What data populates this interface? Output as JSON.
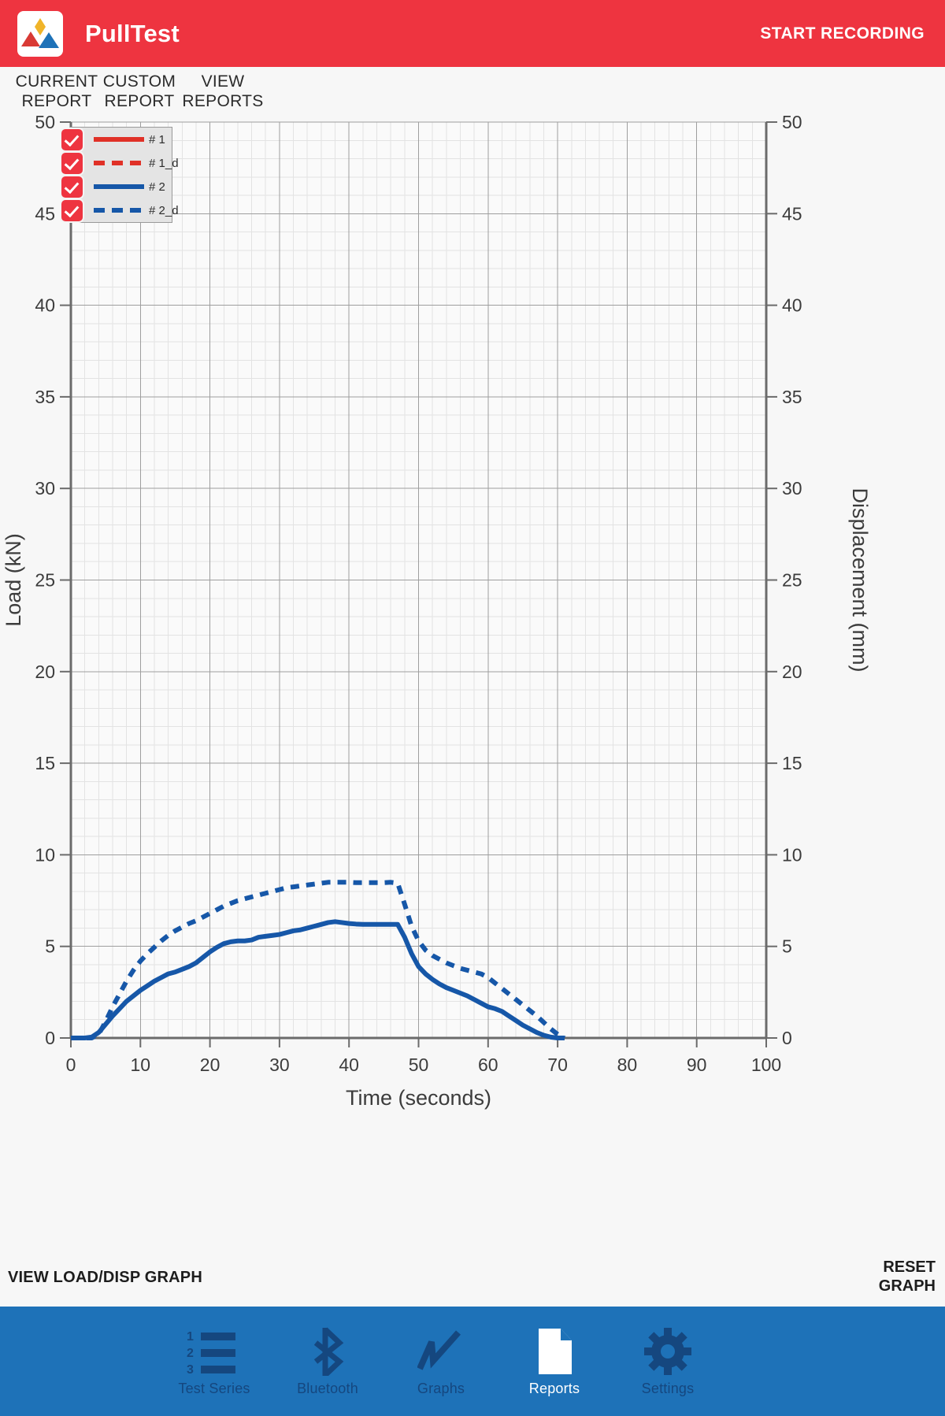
{
  "appbar": {
    "title": "PullTest",
    "start_recording_label": "START RECORDING",
    "logo_icon": "mountains-logo-icon",
    "brand_color": "#ee3440"
  },
  "tabs": [
    {
      "line1": "CURRENT",
      "line2": "REPORT",
      "name": "current-report"
    },
    {
      "line1": "CUSTOM",
      "line2": "REPORT",
      "name": "custom-report"
    },
    {
      "line1": "VIEW",
      "line2": "REPORTS",
      "name": "view-reports"
    }
  ],
  "legend": [
    {
      "label": "# 1",
      "style": "solid",
      "color": "#e03127",
      "checked": true
    },
    {
      "label": "# 1_d",
      "style": "dashed",
      "color": "#e03127",
      "checked": true
    },
    {
      "label": "# 2",
      "style": "solid",
      "color": "#1657a8",
      "checked": true
    },
    {
      "label": "# 2_d",
      "style": "dashed",
      "color": "#1657a8",
      "checked": true
    }
  ],
  "footer": {
    "view_graph_label": "VIEW LOAD/DISP GRAPH",
    "reset_line1": "RESET",
    "reset_line2": "GRAPH"
  },
  "bottomnav": {
    "active": "Reports",
    "items": [
      {
        "label": "Test Series",
        "icon": "numbered-list-icon"
      },
      {
        "label": "Bluetooth",
        "icon": "bluetooth-icon"
      },
      {
        "label": "Graphs",
        "icon": "line-chart-icon"
      },
      {
        "label": "Reports",
        "icon": "document-icon"
      },
      {
        "label": "Settings",
        "icon": "gear-icon"
      }
    ]
  },
  "chart_data": {
    "type": "line",
    "title": "",
    "xlabel": "Time (seconds)",
    "ylabel": "Load (kN)",
    "y2label": "Displacement (mm)",
    "xlim": [
      0,
      100
    ],
    "ylim": [
      0,
      50
    ],
    "y2lim": [
      0,
      50
    ],
    "xticks": [
      0,
      10,
      20,
      30,
      40,
      50,
      60,
      70,
      80,
      90,
      100
    ],
    "yticks": [
      0,
      5,
      10,
      15,
      20,
      25,
      30,
      35,
      40,
      45,
      50
    ],
    "y2ticks": [
      0,
      5,
      10,
      15,
      20,
      25,
      30,
      35,
      40,
      45,
      50
    ],
    "grid": true,
    "minor_grid": true,
    "legend_position": "top-left",
    "series": [
      {
        "name": "# 1",
        "axis": "left",
        "style": "solid",
        "color": "#e03127",
        "x": [],
        "y": []
      },
      {
        "name": "# 1_d",
        "axis": "right",
        "style": "dashed",
        "color": "#e03127",
        "x": [],
        "y": []
      },
      {
        "name": "# 2",
        "axis": "left",
        "style": "solid",
        "color": "#1657a8",
        "x": [
          0,
          1,
          2,
          3,
          4,
          5,
          6,
          7,
          8,
          9,
          10,
          11,
          12,
          13,
          14,
          15,
          16,
          17,
          18,
          19,
          20,
          21,
          22,
          23,
          24,
          25,
          26,
          27,
          28,
          29,
          30,
          31,
          32,
          33,
          34,
          35,
          36,
          37,
          38,
          39,
          40,
          41,
          42,
          43,
          44,
          45,
          46,
          47,
          48,
          49,
          50,
          51,
          52,
          53,
          54,
          55,
          56,
          57,
          58,
          59,
          60,
          61,
          62,
          63,
          64,
          65,
          66,
          67,
          68,
          69,
          70,
          71
        ],
        "y": [
          0,
          0,
          0,
          0.05,
          0.3,
          0.75,
          1.2,
          1.6,
          2.0,
          2.3,
          2.6,
          2.85,
          3.1,
          3.3,
          3.5,
          3.6,
          3.75,
          3.9,
          4.1,
          4.4,
          4.7,
          4.95,
          5.15,
          5.25,
          5.3,
          5.3,
          5.35,
          5.5,
          5.55,
          5.6,
          5.65,
          5.75,
          5.85,
          5.9,
          6.0,
          6.1,
          6.2,
          6.3,
          6.35,
          6.3,
          6.25,
          6.22,
          6.2,
          6.2,
          6.2,
          6.2,
          6.2,
          6.2,
          5.5,
          4.6,
          3.9,
          3.5,
          3.2,
          2.95,
          2.75,
          2.6,
          2.45,
          2.3,
          2.1,
          1.9,
          1.7,
          1.6,
          1.45,
          1.2,
          0.95,
          0.7,
          0.5,
          0.3,
          0.15,
          0.05,
          0,
          0
        ]
      },
      {
        "name": "# 2_d",
        "axis": "right",
        "style": "dashed",
        "color": "#1657a8",
        "x": [
          0,
          1,
          2,
          3,
          4,
          5,
          6,
          7,
          8,
          9,
          10,
          11,
          12,
          13,
          14,
          15,
          16,
          17,
          18,
          19,
          20,
          21,
          22,
          23,
          24,
          25,
          26,
          27,
          28,
          29,
          30,
          31,
          32,
          33,
          34,
          35,
          36,
          37,
          38,
          39,
          40,
          41,
          42,
          43,
          44,
          45,
          46,
          47,
          48,
          49,
          50,
          51,
          52,
          53,
          54,
          55,
          56,
          57,
          58,
          59,
          60,
          61,
          62,
          63,
          64,
          65,
          66,
          67,
          68,
          69,
          70,
          71
        ],
        "y": [
          0,
          0,
          0,
          0,
          0.2,
          0.9,
          1.7,
          2.4,
          3.1,
          3.7,
          4.2,
          4.6,
          4.95,
          5.3,
          5.6,
          5.85,
          6.05,
          6.25,
          6.4,
          6.6,
          6.8,
          7.0,
          7.2,
          7.35,
          7.5,
          7.6,
          7.7,
          7.8,
          7.9,
          8.0,
          8.1,
          8.2,
          8.25,
          8.3,
          8.35,
          8.4,
          8.45,
          8.5,
          8.5,
          8.5,
          8.5,
          8.48,
          8.48,
          8.48,
          8.48,
          8.48,
          8.5,
          8.45,
          7.3,
          6.1,
          5.3,
          4.8,
          4.5,
          4.3,
          4.1,
          3.95,
          3.8,
          3.7,
          3.6,
          3.5,
          3.3,
          3.0,
          2.7,
          2.4,
          2.1,
          1.8,
          1.5,
          1.2,
          0.85,
          0.5,
          0.2,
          0
        ]
      }
    ]
  }
}
